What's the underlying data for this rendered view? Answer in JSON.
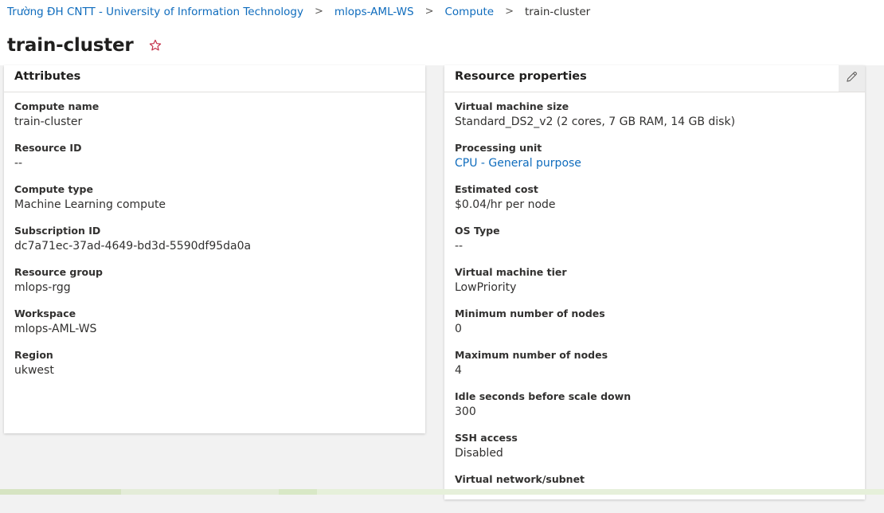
{
  "breadcrumb": {
    "items": [
      {
        "label": "Trường ĐH CNTT - University of Information Technology"
      },
      {
        "label": "mlops-AML-WS"
      },
      {
        "label": "Compute"
      },
      {
        "label": "train-cluster"
      }
    ],
    "separator": ">"
  },
  "header": {
    "title": "train-cluster",
    "favorite_icon": "star-outline-icon"
  },
  "attributes": {
    "title": "Attributes",
    "props": [
      {
        "label": "Compute name",
        "value": "train-cluster"
      },
      {
        "label": "Resource ID",
        "value": "--"
      },
      {
        "label": "Compute type",
        "value": "Machine Learning compute"
      },
      {
        "label": "Subscription ID",
        "value": "dc7a71ec-37ad-4649-bd3d-5590df95da0a"
      },
      {
        "label": "Resource group",
        "value": "mlops-rgg"
      },
      {
        "label": "Workspace",
        "value": "mlops-AML-WS"
      },
      {
        "label": "Region",
        "value": "ukwest"
      }
    ]
  },
  "resource_properties": {
    "title": "Resource properties",
    "edit_icon": "pencil-icon",
    "props": [
      {
        "label": "Virtual machine size",
        "value": "Standard_DS2_v2 (2 cores, 7 GB RAM, 14 GB disk)"
      },
      {
        "label": "Processing unit",
        "value": "CPU - General purpose"
      },
      {
        "label": "Estimated cost",
        "value": "$0.04/hr per node"
      },
      {
        "label": "OS Type",
        "value": "--"
      },
      {
        "label": "Virtual machine tier",
        "value": "LowPriority"
      },
      {
        "label": "Minimum number of nodes",
        "value": "0"
      },
      {
        "label": "Maximum number of nodes",
        "value": "4"
      },
      {
        "label": "Idle seconds before scale down",
        "value": "300"
      },
      {
        "label": "SSH access",
        "value": "Disabled"
      },
      {
        "label": "Virtual network/subnet",
        "value": ""
      }
    ]
  },
  "colors": {
    "link": "#0f6cbd",
    "text": "#323130",
    "star": "#c4314b"
  }
}
